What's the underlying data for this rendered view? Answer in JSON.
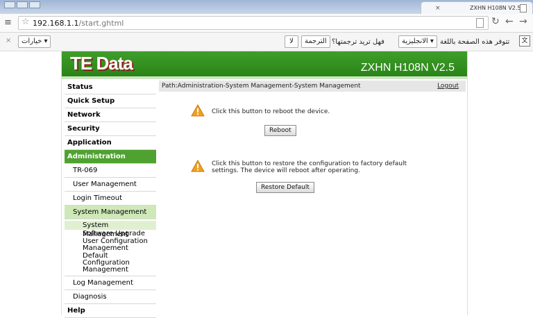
{
  "browser": {
    "tab_title": "ZXHN H108N V2.5",
    "tab_close": "×",
    "url_host": "192.168.1.1",
    "url_path": "/start.ghtml",
    "translate_bar": {
      "close": "×",
      "options": "خيارات ▾",
      "no_button": "لا",
      "translate_button": "الترجمة",
      "question": "فهل تريد ترجمتها؟",
      "language": "الانجليزية ▾",
      "available_text": "تتوفر هذه الصفحة باللغة"
    }
  },
  "router": {
    "logo": "TE Data",
    "model": "ZXHN H108N V2.5",
    "path": "Path:Administration-System Management-System Management",
    "logout": "Logout",
    "menu": {
      "status": "Status",
      "quick_setup": "Quick Setup",
      "network": "Network",
      "security": "Security",
      "application": "Application",
      "administration": "Administration",
      "tr069": "TR-069",
      "user_management": "User Management",
      "login_timeout": "Login Timeout",
      "system_management": "System Management",
      "sm_items": {
        "system_management": "System Management",
        "software_upgrade": "Software Upgrade",
        "user_config_1": "User Configuration",
        "user_config_2": "Management",
        "default_config_1": "Default Configuration",
        "default_config_2": "Management"
      },
      "log_management": "Log Management",
      "diagnosis": "Diagnosis",
      "help": "Help"
    },
    "reboot": {
      "message": "Click this button to reboot the device.",
      "button": "Reboot"
    },
    "restore": {
      "message_line1": "Click this button to restore the configuration to factory default",
      "message_line2": "settings. The device will reboot after operating.",
      "button": "Restore Default"
    }
  },
  "colors": {
    "header_green": "#3f9e2a",
    "active_section": "#4fa230",
    "warning_orange": "#f0a020"
  }
}
